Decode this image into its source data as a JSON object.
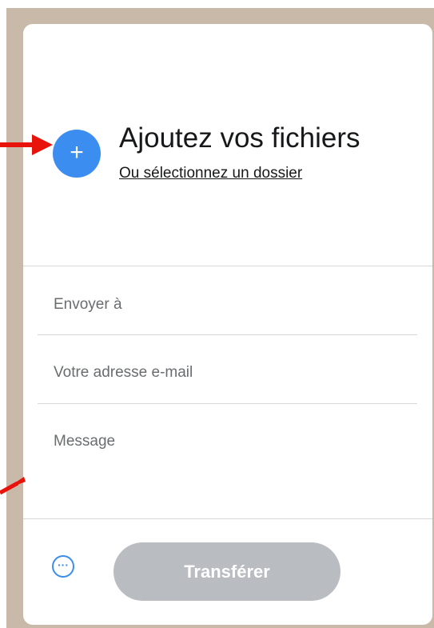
{
  "upload": {
    "add_icon": "plus-icon",
    "add_symbol": "+",
    "title": "Ajoutez vos fichiers",
    "folder_link": "Ou sélectionnez un dossier"
  },
  "form": {
    "recipient_placeholder": "Envoyer à",
    "email_placeholder": "Votre adresse e-mail",
    "message_placeholder": "Message"
  },
  "footer": {
    "more_icon": "more-options-icon",
    "more_symbol": "···",
    "transfer_label": "Transférer"
  },
  "colors": {
    "accent": "#3b8ef0",
    "button_disabled": "#b9bcc0",
    "backdrop": "#c9b9a8",
    "annotation_arrow": "#e8140c"
  }
}
